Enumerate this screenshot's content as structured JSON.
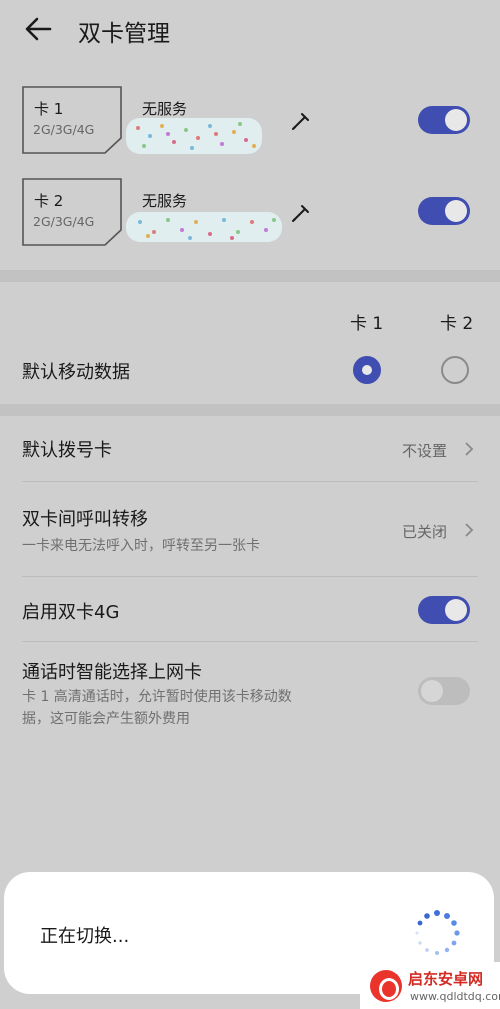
{
  "header": {
    "title": "双卡管理",
    "back_icon": "arrow-left-icon"
  },
  "sims": [
    {
      "name": "卡 1",
      "bands": "2G/3G/4G",
      "status": "无服务",
      "enabled": true
    },
    {
      "name": "卡 2",
      "bands": "2G/3G/4G",
      "status": "无服务",
      "enabled": true
    }
  ],
  "data_section": {
    "col1": "卡 1",
    "col2": "卡 2",
    "label": "默认移动数据",
    "selected": "卡 1"
  },
  "settings": {
    "default_dial": {
      "label": "默认拨号卡",
      "value": "不设置"
    },
    "call_forward": {
      "label": "双卡间呼叫转移",
      "sub": "一卡来电无法呼入时，呼转至另一张卡",
      "value": "已关闭"
    },
    "dual_4g": {
      "label": "启用双卡4G",
      "enabled": true
    },
    "smart_data": {
      "label": "通话时智能选择上网卡",
      "sub1": "卡 1 高清通话时，允许暂时使用该卡移动数",
      "sub2": "据，这可能会产生额外费用",
      "enabled": false
    }
  },
  "dialog": {
    "text": "正在切换..."
  },
  "watermark": {
    "title": "启东安卓网",
    "url": "www.qdldtdq.com"
  },
  "colors": {
    "accent": "#3f4eb0",
    "background": "#cfcfcf",
    "divider": "#c2c2c2"
  }
}
